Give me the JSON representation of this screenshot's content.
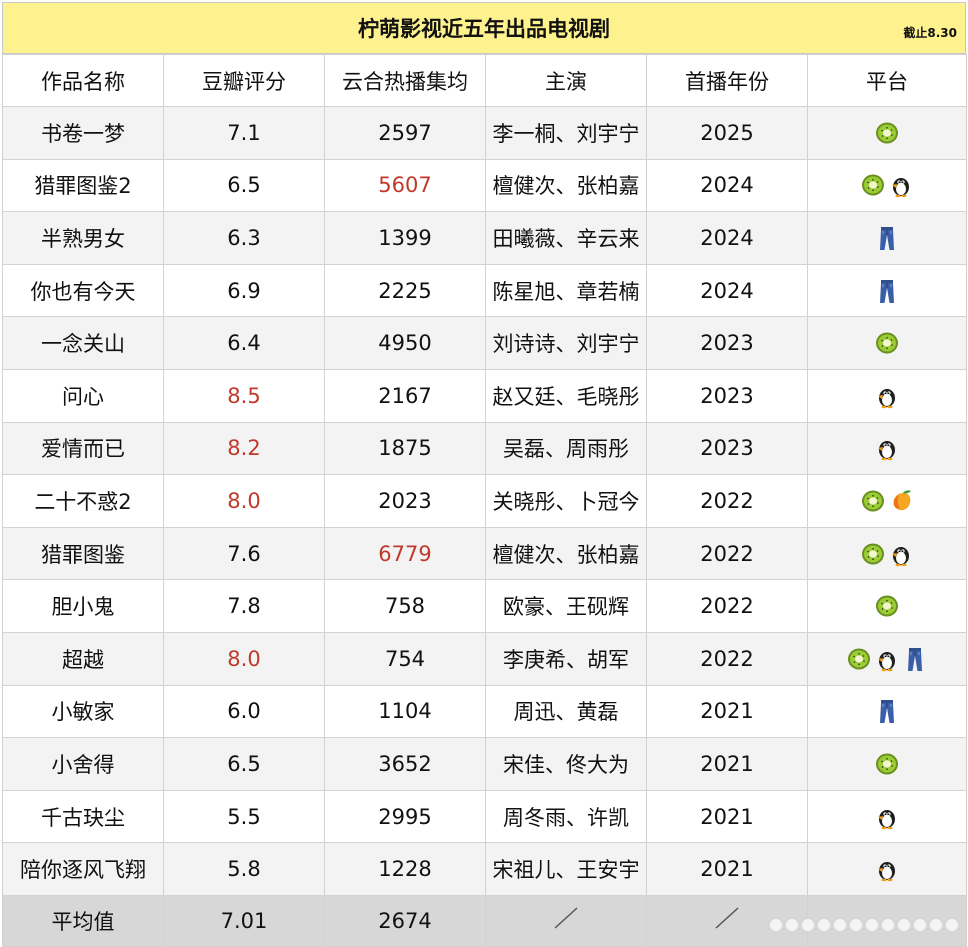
{
  "title": "柠萌影视近五年出品电视剧",
  "note": "截止8.30",
  "headers": [
    "作品名称",
    "豆瓣评分",
    "云合热播集均",
    "主演",
    "首播年份",
    "平台"
  ],
  "rows": [
    {
      "name": "书卷一梦",
      "score": "7.1",
      "score_red": false,
      "heat": "2597",
      "heat_red": false,
      "cast": "李一桐、刘宇宁",
      "year": "2025",
      "platforms": [
        "kiwi-icon"
      ]
    },
    {
      "name": "猎罪图鉴2",
      "score": "6.5",
      "score_red": false,
      "heat": "5607",
      "heat_red": true,
      "cast": "檀健次、张柏嘉",
      "year": "2024",
      "platforms": [
        "kiwi-icon",
        "penguin-icon"
      ]
    },
    {
      "name": "半熟男女",
      "score": "6.3",
      "score_red": false,
      "heat": "1399",
      "heat_red": false,
      "cast": "田曦薇、辛云来",
      "year": "2024",
      "platforms": [
        "jeans-icon"
      ]
    },
    {
      "name": "你也有今天",
      "score": "6.9",
      "score_red": false,
      "heat": "2225",
      "heat_red": false,
      "cast": "陈星旭、章若楠",
      "year": "2024",
      "platforms": [
        "jeans-icon"
      ]
    },
    {
      "name": "一念关山",
      "score": "6.4",
      "score_red": false,
      "heat": "4950",
      "heat_red": false,
      "cast": "刘诗诗、刘宇宁",
      "year": "2023",
      "platforms": [
        "kiwi-icon"
      ]
    },
    {
      "name": "问心",
      "score": "8.5",
      "score_red": true,
      "heat": "2167",
      "heat_red": false,
      "cast": "赵又廷、毛晓彤",
      "year": "2023",
      "platforms": [
        "penguin-icon"
      ]
    },
    {
      "name": "爱情而已",
      "score": "8.2",
      "score_red": true,
      "heat": "1875",
      "heat_red": false,
      "cast": "吴磊、周雨彤",
      "year": "2023",
      "platforms": [
        "penguin-icon"
      ]
    },
    {
      "name": "二十不惑2",
      "score": "8.0",
      "score_red": true,
      "heat": "2023",
      "heat_red": false,
      "cast": "关晓彤、卜冠今",
      "year": "2022",
      "platforms": [
        "kiwi-icon",
        "mango-icon"
      ]
    },
    {
      "name": "猎罪图鉴",
      "score": "7.6",
      "score_red": false,
      "heat": "6779",
      "heat_red": true,
      "cast": "檀健次、张柏嘉",
      "year": "2022",
      "platforms": [
        "kiwi-icon",
        "penguin-icon"
      ]
    },
    {
      "name": "胆小鬼",
      "score": "7.8",
      "score_red": false,
      "heat": "758",
      "heat_red": false,
      "cast": "欧豪、王砚辉",
      "year": "2022",
      "platforms": [
        "kiwi-icon"
      ]
    },
    {
      "name": "超越",
      "score": "8.0",
      "score_red": true,
      "heat": "754",
      "heat_red": false,
      "cast": "李庚希、胡军",
      "year": "2022",
      "platforms": [
        "kiwi-icon",
        "penguin-icon",
        "jeans-icon"
      ]
    },
    {
      "name": "小敏家",
      "score": "6.0",
      "score_red": false,
      "heat": "1104",
      "heat_red": false,
      "cast": "周迅、黄磊",
      "year": "2021",
      "platforms": [
        "jeans-icon"
      ]
    },
    {
      "name": "小舍得",
      "score": "6.5",
      "score_red": false,
      "heat": "3652",
      "heat_red": false,
      "cast": "宋佳、佟大为",
      "year": "2021",
      "platforms": [
        "kiwi-icon"
      ]
    },
    {
      "name": "千古玦尘",
      "score": "5.5",
      "score_red": false,
      "heat": "2995",
      "heat_red": false,
      "cast": "周冬雨、许凯",
      "year": "2021",
      "platforms": [
        "penguin-icon"
      ]
    },
    {
      "name": "陪你逐风飞翔",
      "score": "5.8",
      "score_red": false,
      "heat": "1228",
      "heat_red": false,
      "cast": "宋祖儿、王安宇",
      "year": "2021",
      "platforms": [
        "penguin-icon"
      ]
    }
  ],
  "average": {
    "label": "平均值",
    "score": "7.01",
    "heat": "2674"
  },
  "colors": {
    "title_bg": "#fdf28e",
    "highlight": "#c0392b",
    "stripe": "#f3f3f3",
    "avg_bg": "#d7d7d7"
  }
}
